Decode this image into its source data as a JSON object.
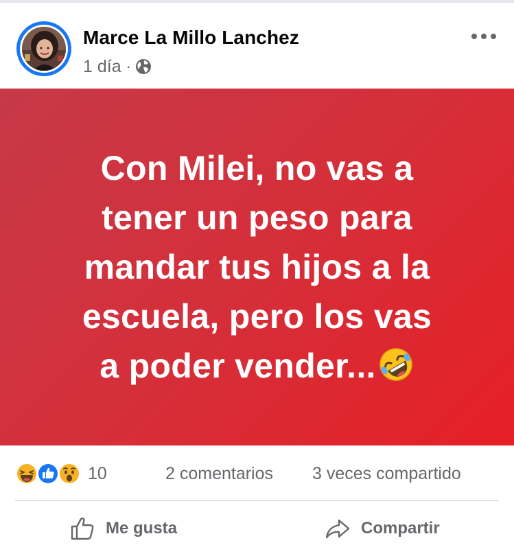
{
  "post": {
    "author": "Marce La Millo Lanchez",
    "time": "1 día",
    "separator": "·",
    "privacy_icon": "globe-icon",
    "more_icon": "more-options-icon",
    "banner": {
      "lines": [
        "Con Milei, no vas a",
        "tener un peso para",
        "mandar tus hijos a la",
        "escuela, pero los vas",
        "a poder vender..."
      ],
      "emoji": "rolling-on-floor-laughing-emoji",
      "gradient_colors": [
        "#c63947",
        "#e61f26"
      ],
      "text_color": "#ffffff"
    }
  },
  "reactions": {
    "icons": [
      "haha-reaction-icon",
      "like-reaction-icon",
      "wow-reaction-icon"
    ],
    "count": "10",
    "comments": "2 comentarios",
    "shares": "3 veces compartido"
  },
  "actions": {
    "like_label": "Me gusta",
    "share_label": "Compartir"
  },
  "colors": {
    "accent": "#1877f2",
    "secondary_text": "#65676b",
    "primary_text": "#050505"
  }
}
